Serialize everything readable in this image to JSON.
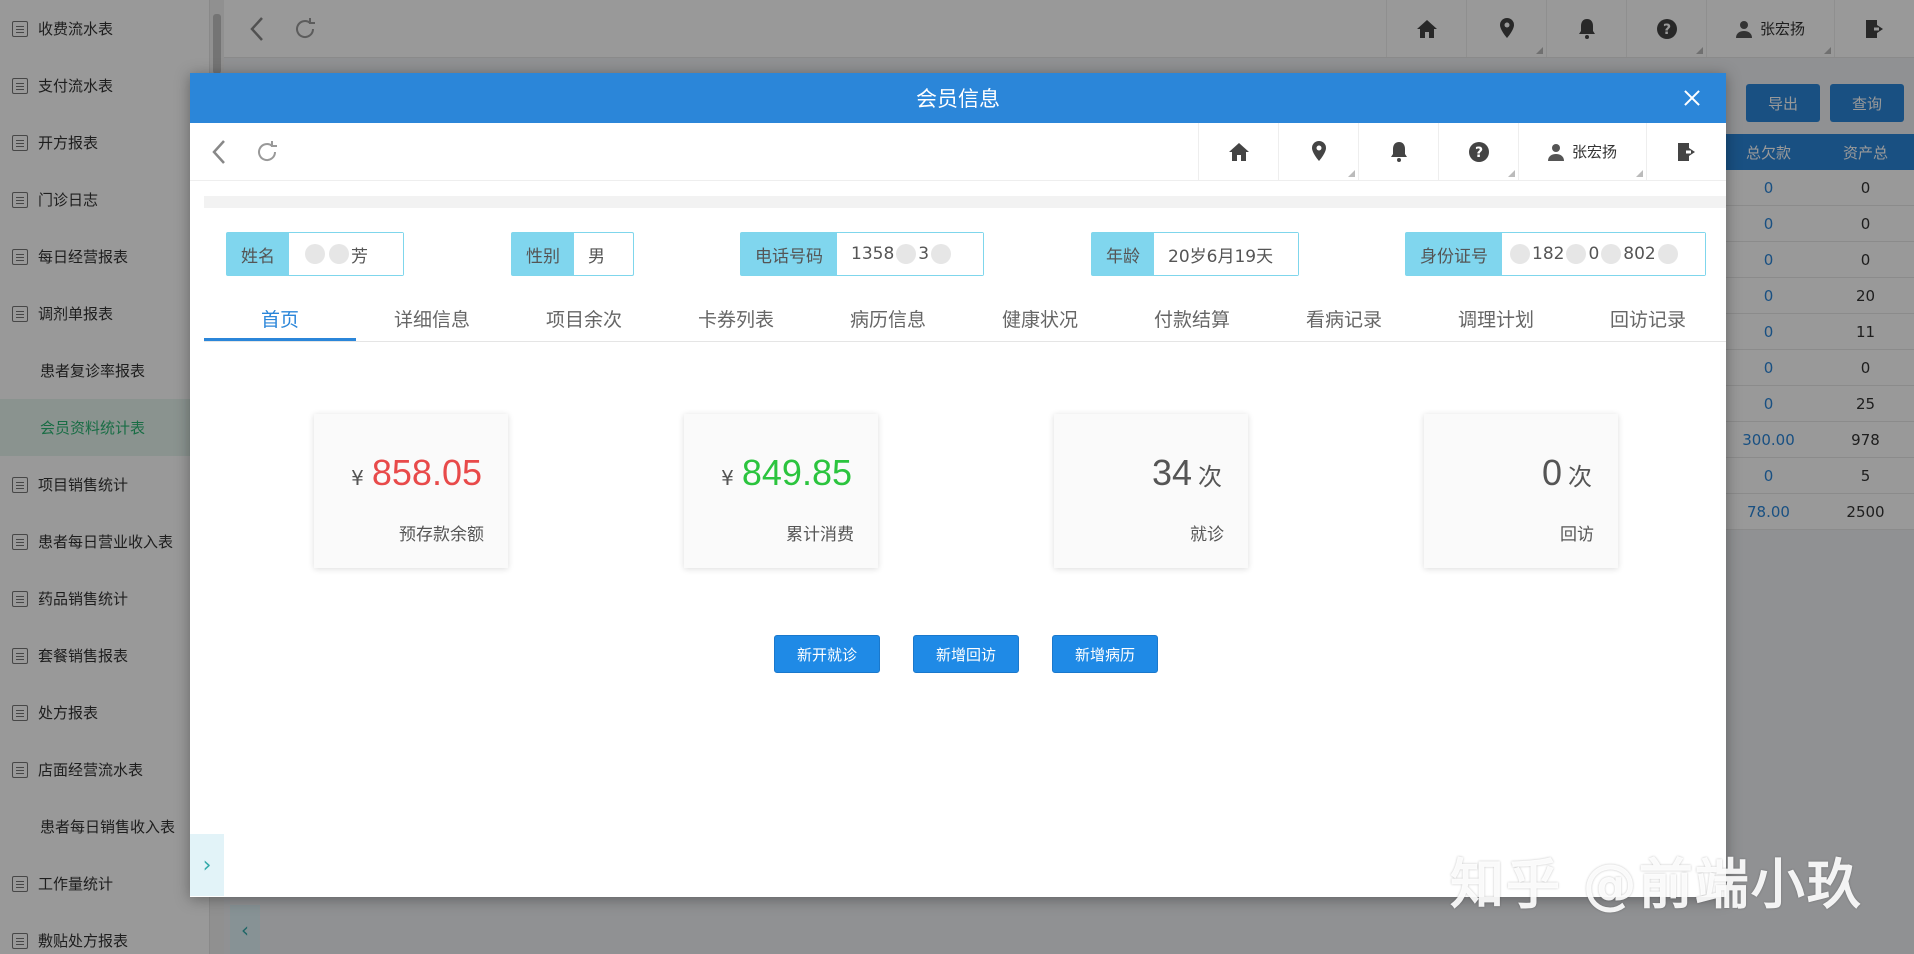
{
  "sidebar": {
    "items": [
      {
        "label": "收费流水表",
        "icon": "report-icon"
      },
      {
        "label": "支付流水表",
        "icon": "wallet-icon"
      },
      {
        "label": "开方报表",
        "icon": "report-icon"
      },
      {
        "label": "门诊日志",
        "icon": "report-icon"
      },
      {
        "label": "每日经营报表",
        "icon": "report-icon"
      },
      {
        "label": "调剂单报表",
        "icon": "report-icon"
      },
      {
        "label": "患者复诊率报表",
        "icon": ""
      },
      {
        "label": "会员资料统计表",
        "icon": "",
        "active": true
      },
      {
        "label": "项目销售统计",
        "icon": "chart-icon"
      },
      {
        "label": "患者每日营业收入表",
        "icon": "report-icon"
      },
      {
        "label": "药品销售统计",
        "icon": "medicine-icon"
      },
      {
        "label": "套餐销售报表",
        "icon": "package-icon"
      },
      {
        "label": "处方报表",
        "icon": "prescription-icon"
      },
      {
        "label": "店面经营流水表",
        "icon": "report-icon"
      },
      {
        "label": "患者每日销售收入表",
        "icon": ""
      },
      {
        "label": "工作量统计",
        "icon": "report-icon"
      },
      {
        "label": "敷贴处方报表",
        "icon": "report-icon"
      }
    ]
  },
  "topbar": {
    "user": "张宏扬"
  },
  "bg_actions": {
    "export": "导出",
    "query": "查询"
  },
  "bg_table": {
    "headers": [
      "总欠款",
      "资产总"
    ],
    "rows": [
      [
        "0",
        "0"
      ],
      [
        "0",
        "0"
      ],
      [
        "0",
        "0"
      ],
      [
        "0",
        "20"
      ],
      [
        "0",
        "11"
      ],
      [
        "0",
        "0"
      ],
      [
        "0",
        "25"
      ],
      [
        "300.00",
        "978"
      ],
      [
        "0",
        "5"
      ],
      [
        "78.00",
        "2500"
      ]
    ]
  },
  "modal": {
    "title": "会员信息",
    "user": "张宏扬",
    "fields": {
      "name_label": "姓名",
      "name_value": "芳",
      "gender_label": "性别",
      "gender_value": "男",
      "phone_label": "电话号码",
      "phone_value_a": "1358",
      "phone_value_b": "3",
      "age_label": "年龄",
      "age_value": "20岁6月19天",
      "id_label": "身份证号",
      "id_value_a": "182",
      "id_value_b": "0",
      "id_value_c": "802"
    },
    "tabs": [
      "首页",
      "详细信息",
      "项目余次",
      "卡券列表",
      "病历信息",
      "健康状况",
      "付款结算",
      "看病记录",
      "调理计划",
      "回访记录"
    ],
    "active_tab": "首页",
    "cards": [
      {
        "currency": "¥",
        "value": "858.05",
        "label": "预存款余额",
        "color": "#e84a4a"
      },
      {
        "currency": "¥",
        "value": "849.85",
        "label": "累计消费",
        "color": "#2bc43e"
      },
      {
        "value": "34",
        "unit": "次",
        "label": "就诊"
      },
      {
        "value": "0",
        "unit": "次",
        "label": "回访"
      }
    ],
    "buttons": {
      "new_visit": "新开就诊",
      "new_followup": "新增回访",
      "new_record": "新增病历"
    }
  },
  "watermark": "知乎 @前端小玖",
  "colors": {
    "primary": "#2b86d9",
    "label_bg": "#80d6ee",
    "red": "#e84a4a",
    "green": "#2bc43e"
  }
}
